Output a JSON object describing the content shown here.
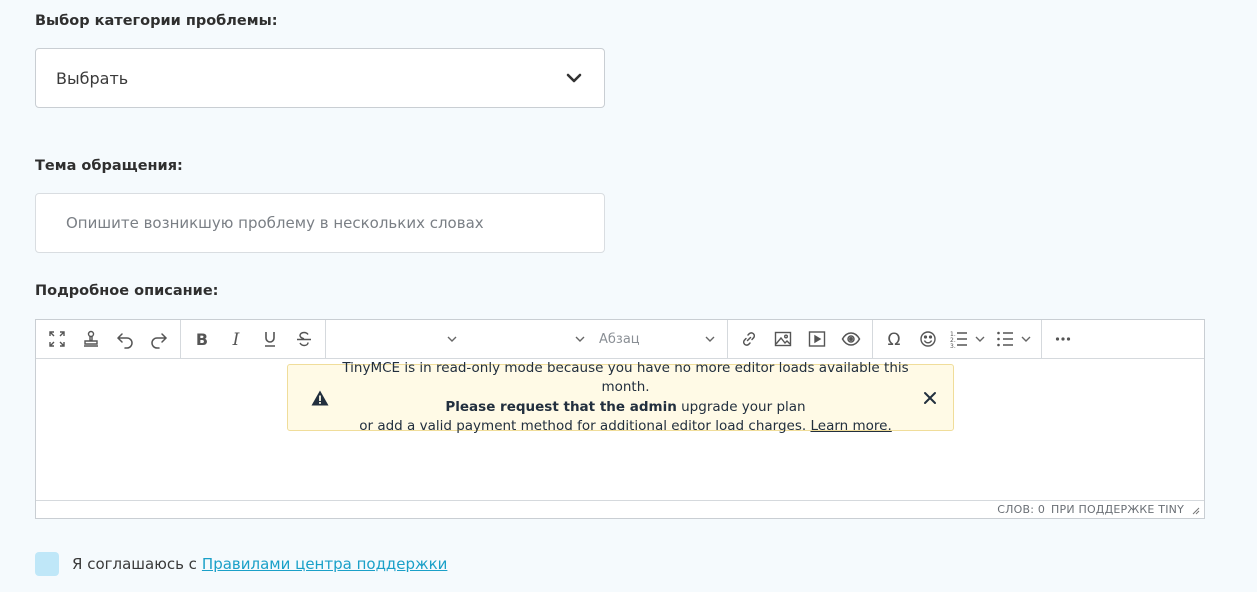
{
  "category": {
    "label": "Выбор категории проблемы:",
    "selected": "Выбрать"
  },
  "subject": {
    "label": "Тема обращения:",
    "placeholder": "Опишите возникшую проблему в нескольких словах"
  },
  "description": {
    "label": "Подробное описание:",
    "toolbar": {
      "format_select": "Абзац"
    },
    "notice": {
      "line1": "TinyMCE is in read-only mode because you have no more editor loads available this month.",
      "line2_bold": "Please request that the admin",
      "line2_rest": " upgrade your plan",
      "line3": "or add a valid payment method for additional editor load charges. ",
      "link": "Learn more."
    },
    "statusbar": {
      "words": "СЛОВ: 0",
      "powered": "ПРИ ПОДДЕРЖКЕ TINY"
    }
  },
  "agreement": {
    "text": "Я соглашаюсь с",
    "link": "Правилами центра поддержки"
  }
}
